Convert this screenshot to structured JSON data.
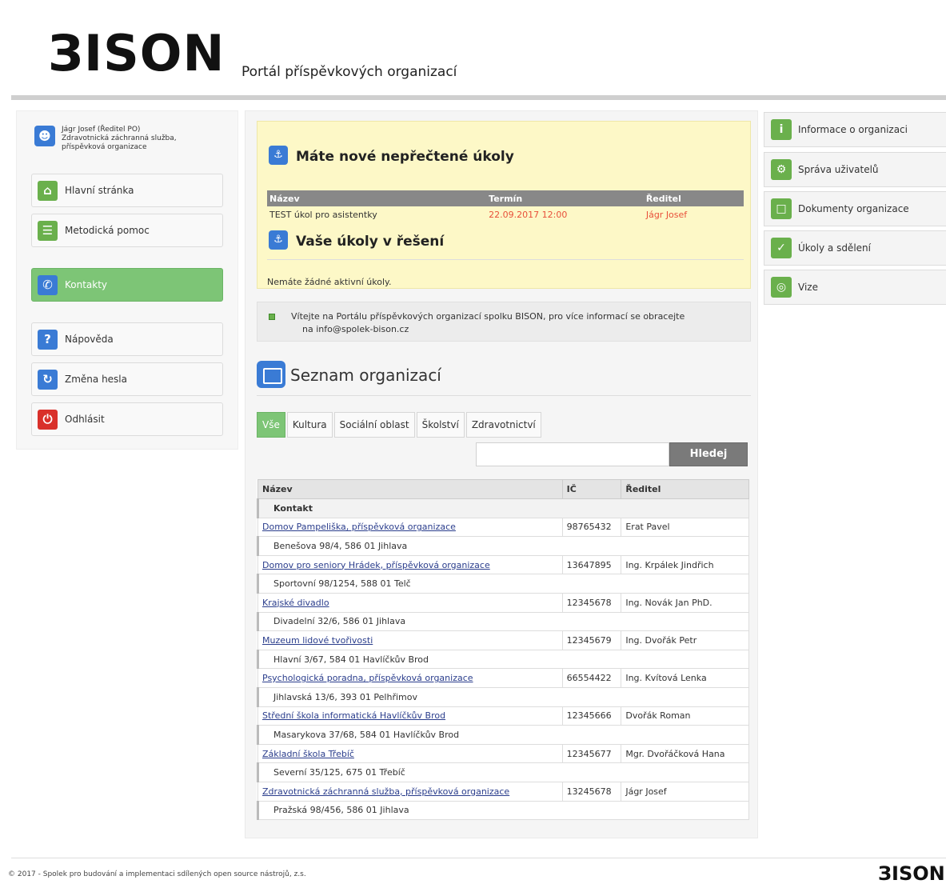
{
  "header": {
    "logo": "ЗISON",
    "portal_title": "Portál příspěvkových organizací"
  },
  "user": {
    "name_role": "Jágr Josef (Ředitel PO)",
    "org_line1": "Zdravotnická záchranná služba,",
    "org_line2": "příspěvková organizace"
  },
  "nav": {
    "home": "Hlavní stránka",
    "methodic": "Metodická pomoc",
    "contacts": "Kontakty",
    "help": "Nápověda",
    "change_password": "Změna hesla",
    "logout": "Odhlásit"
  },
  "tasks": {
    "new_heading": "Máte nové nepřečtené úkoly",
    "columns": [
      "Název",
      "Termín",
      "Ředitel"
    ],
    "rows": [
      {
        "name": "TEST úkol pro asistentky",
        "deadline": "22.09.2017 12:00",
        "director": "Jágr Josef"
      }
    ],
    "active_heading": "Vaše úkoly v řešení",
    "no_tasks": "Nemáte žádné aktivní úkoly."
  },
  "welcome": {
    "line1": "Vítejte na Portálu příspěvkových organizací spolku BISON, pro více informací se obracejte",
    "line2": "na info@spolek-bison.cz"
  },
  "org_list": {
    "title": "Seznam organizací",
    "tabs": [
      "Vše",
      "Kultura",
      "Sociální oblast",
      "Školství",
      "Zdravotnictví"
    ],
    "search_button": "Hledej",
    "columns": [
      "Název",
      "IČ",
      "Ředitel"
    ],
    "group": "Kontakt",
    "rows": [
      {
        "name": "Domov Pampeliška, příspěvková organizace",
        "ic": "98765432",
        "director": "Erat Pavel",
        "address": "Benešova 98/4, 586 01 Jihlava"
      },
      {
        "name": "Domov pro seniory Hrádek, příspěvková organizace",
        "ic": "13647895",
        "director": "Ing. Krpálek Jindřich",
        "address": "Sportovní 98/1254, 588 01 Telč"
      },
      {
        "name": "Krajské divadlo",
        "ic": "12345678",
        "director": "Ing. Novák Jan PhD.",
        "address": "Divadelní 32/6, 586 01 Jihlava"
      },
      {
        "name": "Muzeum lidové tvořivosti",
        "ic": "12345679",
        "director": "Ing. Dvořák Petr",
        "address": "Hlavní 3/67, 584 01 Havlíčkův Brod"
      },
      {
        "name": "Psychologická poradna, příspěvková organizace",
        "ic": "66554422",
        "director": "Ing. Kvítová Lenka",
        "address": "Jihlavská 13/6, 393 01 Pelhřimov"
      },
      {
        "name": "Střední škola informatická Havlíčkův Brod",
        "ic": "12345666",
        "director": "Dvořák Roman",
        "address": "Masarykova 37/68, 584 01 Havlíčkův Brod"
      },
      {
        "name": "Základní škola Třebíč",
        "ic": "12345677",
        "director": "Mgr. Dvořáčková Hana",
        "address": "Severní 35/125, 675 01 Třebíč"
      },
      {
        "name": "Zdravotnická záchranná služba, příspěvková organizace",
        "ic": "13245678",
        "director": "Jágr Josef",
        "address": "Pražská 98/456, 586 01 Jihlava"
      }
    ]
  },
  "right_nav": {
    "org_info": "Informace o organizaci",
    "users": "Správa uživatelů",
    "documents": "Dokumenty organizace",
    "tasks_messages": "Úkoly a sdělení",
    "vision": "Vize"
  },
  "footer": {
    "copyright": "© 2017 - Spolek pro budování a implementaci sdílených open source nástrojů, z.s.",
    "logo": "ЗISON"
  },
  "colors": {
    "accent_green": "#7dc576",
    "icon_blue": "#3a7bd5",
    "alert_yellow": "#fdf8c7",
    "deadline_red": "#e8503a"
  }
}
